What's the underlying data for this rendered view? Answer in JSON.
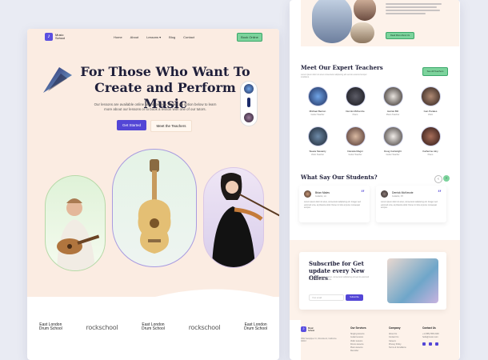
{
  "left": {
    "logo": {
      "mark": "♪",
      "text": "Music School"
    },
    "nav": [
      "Home",
      "About",
      "Lessons ▾",
      "Blog",
      "Contact"
    ],
    "book_button": "Book Online",
    "hero_title": "For Those Who Want To Create and Perform Music",
    "hero_sub": "Our lessons are available online and in person. Select an option below to learn more about our lessons or to book a lesson with one of our tutors.",
    "primary_button": "Get Started",
    "secondary_button": "Meet the Teachers",
    "brands": [
      {
        "line1": "East London",
        "line2": "Drum School"
      },
      {
        "line1": "rockschool",
        "line2": ""
      },
      {
        "line1": "East London",
        "line2": "Drum School"
      },
      {
        "line1": "rockschool",
        "line2": ""
      },
      {
        "line1": "East London",
        "line2": "Drum School"
      }
    ]
  },
  "right": {
    "top_button": "Read More About Us",
    "teachers_title": "Meet Our Expert Teachers",
    "teachers_sub": "Lorem ipsum dolor sit amet consectetur adipiscing elit sed do eiusmod tempor incididunt.",
    "teachers_button": "See All Teachers",
    "teachers": [
      {
        "name": "Michael Benton",
        "role": "Guitar Teacher"
      },
      {
        "name": "Dennis McKenzie",
        "role": "Piano"
      },
      {
        "name": "Harriet Bill",
        "role": "Piano Teacher"
      },
      {
        "name": "Ivan Parales",
        "role": "Violin"
      },
      {
        "name": "Steela Stewarty",
        "role": "Violin Teacher"
      },
      {
        "name": "Daniela Magni",
        "role": "Guitar Teacher"
      },
      {
        "name": "Doug Cartwright",
        "role": "Guitar Teacher"
      },
      {
        "name": "Katherine Ainy",
        "role": "Piano"
      }
    ],
    "students_title": "What Say Our Students?",
    "reviews": [
      {
        "name": "Brian Males",
        "role": "Guitarist, LA",
        "text": "Lorem ipsum dolor sit amet, consectetur adipiscing elit. Integer sed euismod urna, at pharetra dolor. Donec in felis at purus consequat tempus."
      },
      {
        "name": "Derrick McKenzie",
        "role": "Guitarist, NY",
        "text": "Lorem ipsum dolor sit amet, consectetur adipiscing elit. Integer sed euismod urna, at pharetra dolor. Donec in felis at purus consequat tempus."
      }
    ],
    "subscribe_title": "Subscribe for Get update every New Offers",
    "subscribe_text": "Lorem ipsum dolor sit amet, consectetur adipiscing elit sed do eiusmod tempor incididunt ut labore.",
    "subscribe_placeholder": "Your email",
    "subscribe_button": "Subscribe",
    "footer": {
      "logo_text": "Music School",
      "address": "3892 Sandpiper Ct, Woodstock, California 94043",
      "col1_title": "Our Services",
      "col1": [
        "Singing lessons",
        "Guitar lessons",
        "Violin lessons",
        "Drums lessons",
        "Piano lessons",
        "Recorder"
      ],
      "col2_title": "Company",
      "col2": [
        "About Us",
        "Contact Us",
        "Careers",
        "Privacy Policy",
        "Terms & Conditions"
      ],
      "col3_title": "Contact Us",
      "phone": "+1 (555) 555-0100",
      "email": "hello@music.com"
    }
  },
  "colors": {
    "accent": "#5346d6",
    "green": "#7cd39c",
    "peach": "#fbece2"
  }
}
